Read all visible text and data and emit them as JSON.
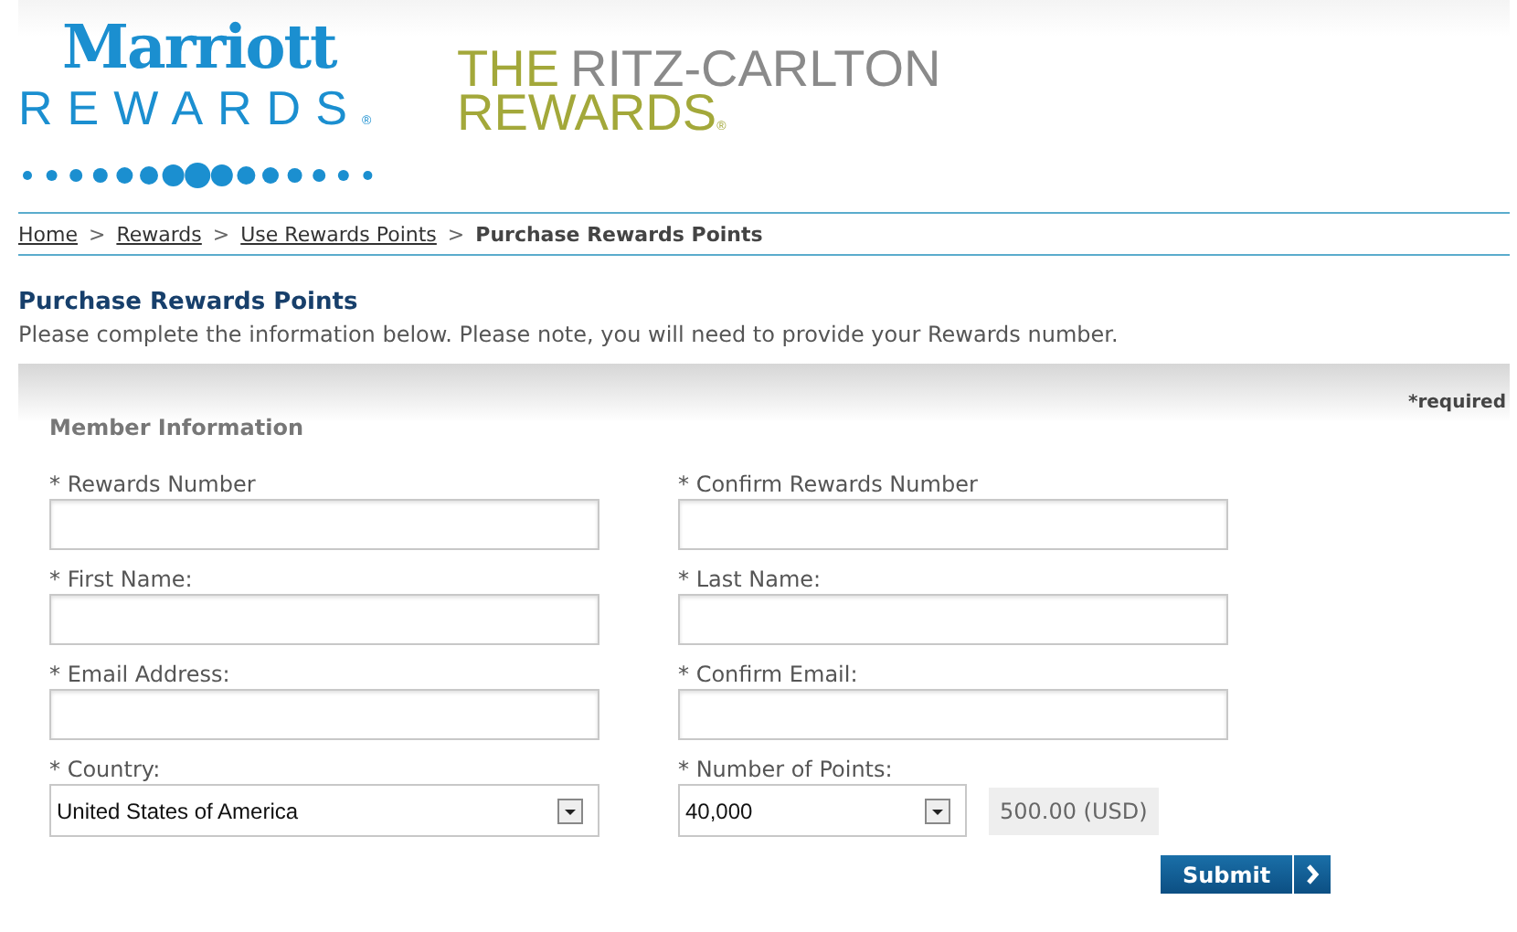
{
  "header": {
    "marriott_logo": {
      "wordmark": "Marriott",
      "sub": "REWARDS",
      "mark": "®"
    },
    "ritz_logo": {
      "first": "THE",
      "second": "RITZ-CARLTON",
      "third": "REWARDS",
      "mark": "®"
    }
  },
  "breadcrumb": [
    {
      "label": "Home",
      "kind": "link"
    },
    {
      "label": "Rewards",
      "kind": "link"
    },
    {
      "label": "Use Rewards Points",
      "kind": "link"
    },
    {
      "label": "Purchase Rewards Points",
      "kind": "current"
    }
  ],
  "breadcrumb_separator": ">",
  "page_title": "Purchase Rewards Points",
  "intro": "Please complete the information below. Please note, you will need to provide your Rewards number.",
  "form": {
    "required_note": "*required",
    "section_title": "Member Information",
    "fields": [
      {
        "label": "* Rewards Number",
        "kind": "text"
      },
      {
        "label": "* Confirm Rewards Number",
        "kind": "text"
      },
      {
        "label": "* First Name:",
        "kind": "text"
      },
      {
        "label": "* Last Name:",
        "kind": "text"
      },
      {
        "label": "* Email Address:",
        "kind": "text"
      },
      {
        "label": "* Confirm Email:",
        "kind": "text"
      },
      {
        "label": "* Country:",
        "kind": "select",
        "value": "United States of America"
      },
      {
        "label": "* Number of Points:",
        "kind": "select",
        "value": "40,000",
        "price": "500.00 (USD)"
      }
    ],
    "submit": "Submit"
  }
}
